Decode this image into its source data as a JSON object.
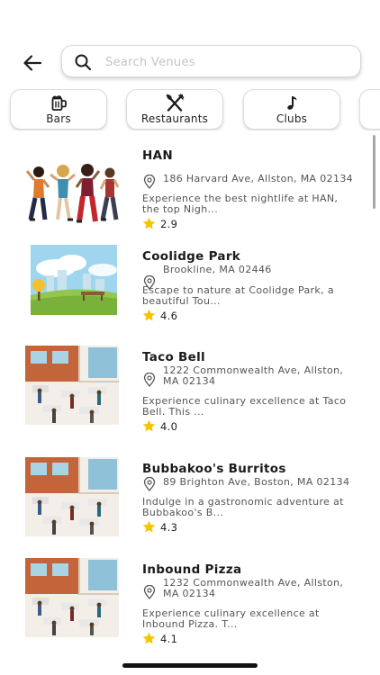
{
  "search": {
    "placeholder": "Search Venues",
    "value": ""
  },
  "icons": {
    "back": "arrow-left-icon",
    "search": "magnifier-icon",
    "location": "location-pin-icon",
    "star": "star-icon"
  },
  "categories": [
    {
      "label": "Bars",
      "icon": "beer-mug-icon"
    },
    {
      "label": "Restaurants",
      "icon": "fork-knife-icon"
    },
    {
      "label": "Clubs",
      "icon": "music-note-icon"
    },
    {
      "label": "",
      "icon": ""
    }
  ],
  "venues": [
    {
      "name": "HAN",
      "address": "186 Harvard Ave, Allston, MA 02134",
      "description": "Experience the best nightlife at HAN, the top Nigh...",
      "rating": "2.9",
      "image": "dancing-people-illustration"
    },
    {
      "name": "Coolidge Park",
      "address": "Brookline, MA 02446",
      "description": "Escape to nature at Coolidge Park, a beautiful Tou...",
      "rating": "4.6",
      "image": "park-illustration"
    },
    {
      "name": "Taco Bell",
      "address": "1222 Commonwealth Ave, Allston, MA 02134",
      "description": "Experience culinary excellence at Taco Bell. This ...",
      "rating": "4.0",
      "image": "restaurant-interior-illustration"
    },
    {
      "name": "Bubbakoo's Burritos",
      "address": "89 Brighton Ave, Boston, MA 02134",
      "description": "Indulge in a gastronomic adventure at Bubbakoo's B...",
      "rating": "4.3",
      "image": "restaurant-interior-illustration"
    },
    {
      "name": "Inbound Pizza",
      "address": "1232 Commonwealth Ave, Allston, MA 02134",
      "description": "Experience culinary excellence at Inbound Pizza. T...",
      "rating": "4.1",
      "image": "restaurant-interior-illustration"
    }
  ],
  "colors": {
    "star": "#f5c400",
    "text": "#1b1b1b",
    "muted": "#555555",
    "border": "#dcdcdc"
  }
}
